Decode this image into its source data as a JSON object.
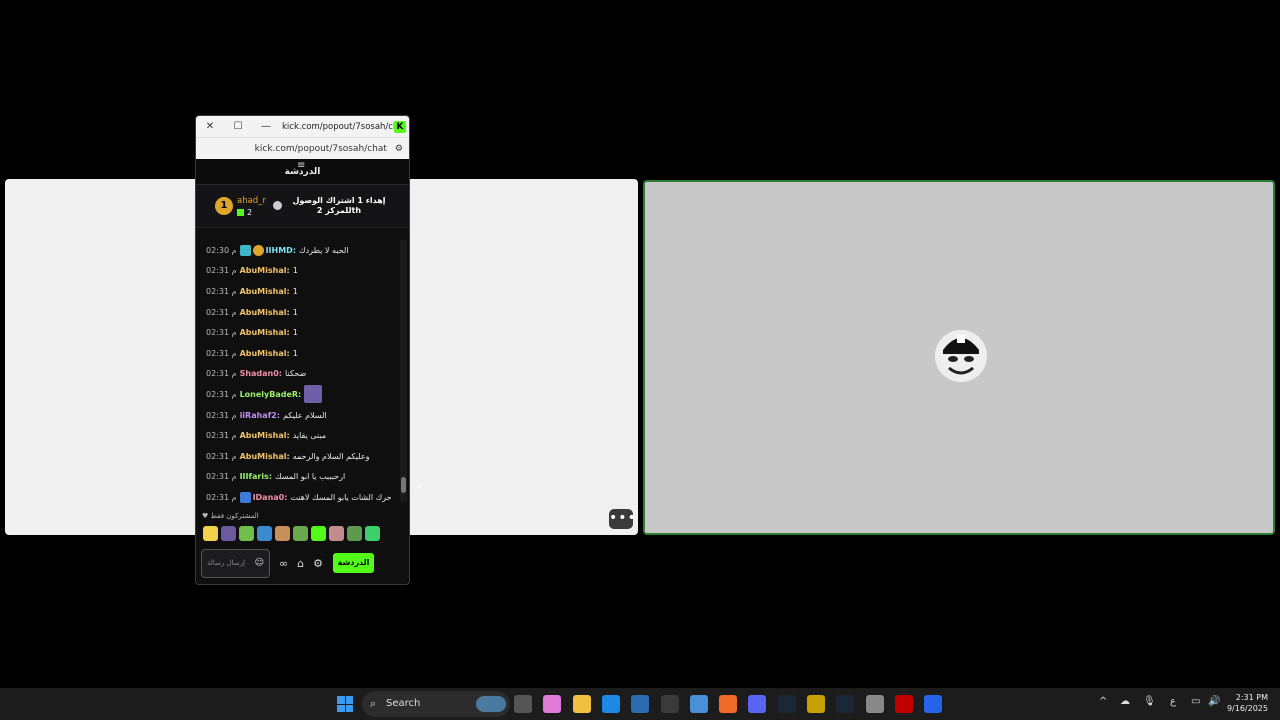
{
  "window": {
    "title_url": "kick.com/popout/7sosah/ch...",
    "address": "kick.com/popout/7sosah/chat",
    "close_symbol": "✕",
    "maximize_symbol": "☐",
    "minimize_symbol": "—",
    "logo_letter": "K"
  },
  "chat": {
    "header": "الدردشة",
    "pinned": {
      "rank": "1",
      "username": "ahad_r",
      "count": "2",
      "text": "إهداء 1 اشتراك الوصول للمركز 2th"
    },
    "messages": [
      {
        "time": "02:30 م",
        "user": "IIHMD:",
        "text": "الحبه لا يطردك",
        "user_color": "#7fe3f0",
        "badges": [
          "#3fb6c9",
          "#e0a52b"
        ]
      },
      {
        "time": "02:31 م",
        "user": "AbuMishal:",
        "text": "1",
        "user_color": "#f4c36b",
        "badges": []
      },
      {
        "time": "02:31 م",
        "user": "AbuMishal:",
        "text": "1",
        "user_color": "#f4c36b",
        "badges": []
      },
      {
        "time": "02:31 م",
        "user": "AbuMishal:",
        "text": "1",
        "user_color": "#f4c36b",
        "badges": []
      },
      {
        "time": "02:31 م",
        "user": "AbuMishal:",
        "text": "1",
        "user_color": "#f4c36b",
        "badges": []
      },
      {
        "time": "02:31 م",
        "user": "AbuMishal:",
        "text": "1",
        "user_color": "#f4c36b",
        "badges": []
      },
      {
        "time": "02:31 م",
        "user": "Shadan0:",
        "text": "ضحكنا",
        "user_color": "#f08fa5",
        "badges": []
      },
      {
        "time": "02:31 م",
        "user": "LonelyBadeR:",
        "text": "",
        "user_color": "#9cf06b",
        "badges": [],
        "emote": "#6d5fa8"
      },
      {
        "time": "02:31 م",
        "user": "iiRahaf2:",
        "text": "السلام عليكم",
        "user_color": "#c08ff0",
        "badges": []
      },
      {
        "time": "02:31 م",
        "user": "AbuMishal:",
        "text": "مبنى يقايد",
        "user_color": "#f4c36b",
        "badges": []
      },
      {
        "time": "02:31 م",
        "user": "AbuMishal:",
        "text": "وعليكم السلام والرحمه",
        "user_color": "#f4c36b",
        "badges": []
      },
      {
        "time": "02:31 م",
        "user": "IIIfaris:",
        "text": "ارحبببب يا ابو المسك",
        "user_color": "#9cf06b",
        "badges": []
      },
      {
        "time": "02:31 م",
        "user": "IDana0:",
        "text": "حرك الشات يابو المسك لاهنت",
        "user_color": "#f08fa5",
        "badges": [
          "#3d7bd6"
        ]
      }
    ],
    "subs_only_label": "المشتركون فقط",
    "emote_colors": [
      "#f2d24b",
      "#6b5aa0",
      "#6fbf4a",
      "#3c8ad0",
      "#c98f5a",
      "#6aa84f",
      "#53fc18",
      "#c28c8c",
      "#5e9a4e",
      "#3fcf6a"
    ],
    "input_placeholder": "إرسال رسالة",
    "send_label": "الدردشة"
  },
  "taskbar": {
    "search_placeholder": "Search",
    "time": "2:31 PM",
    "date": "9/16/2025",
    "lang": "ع",
    "app_colors": [
      "#555555",
      "#e07ad6",
      "#f0c040",
      "#1e88e5",
      "#2b6cb0",
      "#3a3a3a",
      "#4a90d9",
      "#f06a2a",
      "#5865f2",
      "#1b2838",
      "#c8a000",
      "#1b2838",
      "#888888",
      "#c00000",
      "#2563eb"
    ]
  }
}
